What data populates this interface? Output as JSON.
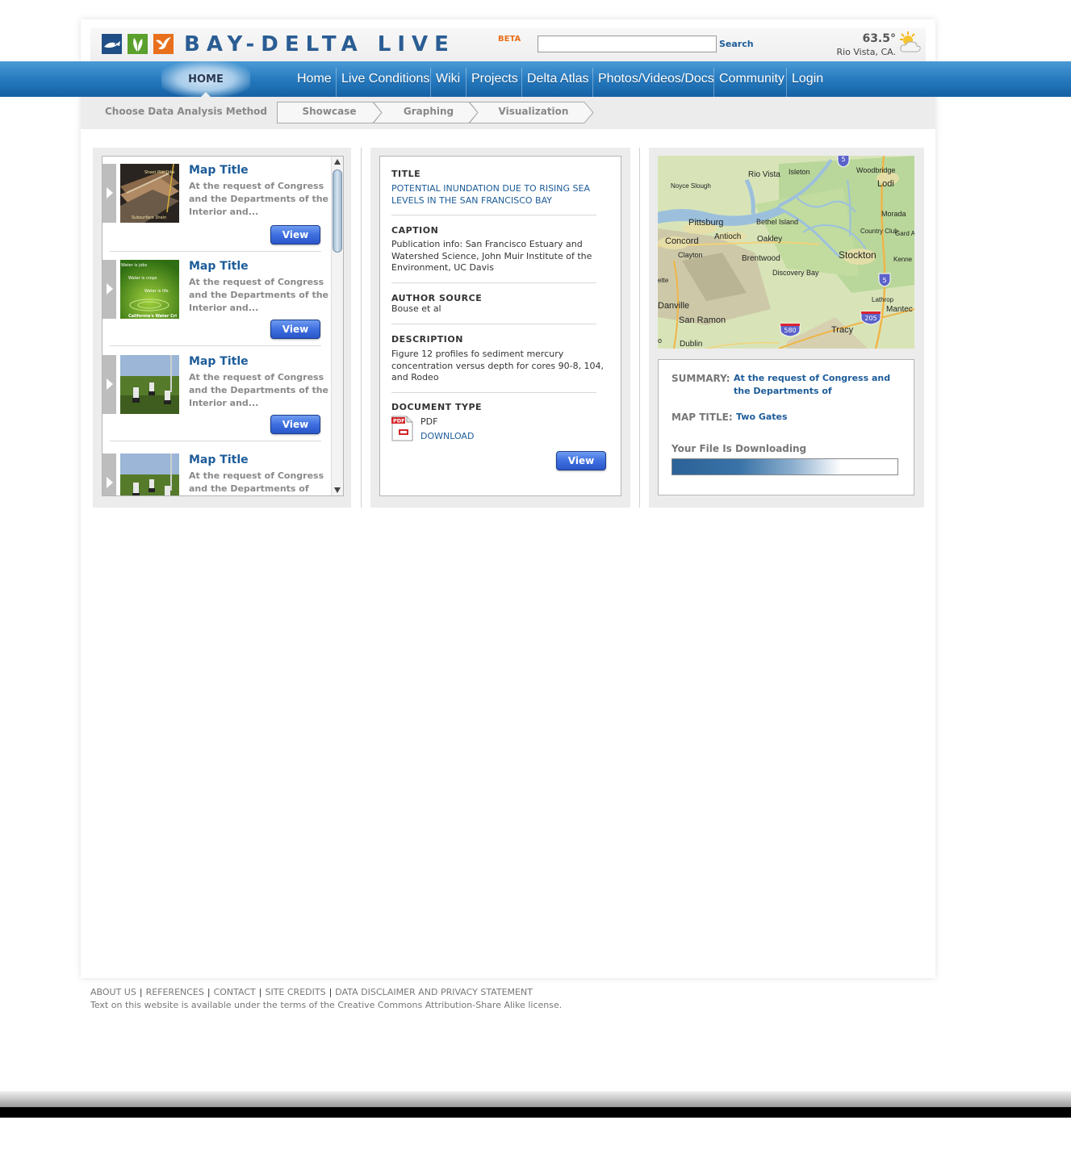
{
  "header": {
    "brand": "BAY-DELTA LIVE",
    "beta": "BETA",
    "search_placeholder": "",
    "search_label": "Search",
    "weather": {
      "temp": "63.5°",
      "city": "Rio Vista, CA.",
      "icon": "partly-cloudy-icon"
    }
  },
  "nav": {
    "home": "HOME",
    "items": [
      "Home",
      "Live Conditions",
      "Wiki",
      "Projects",
      "Delta Atlas",
      "Photos/Videos/Docs",
      "Community",
      "Login"
    ]
  },
  "breadcrumb": {
    "label": "Choose Data Analysis Method",
    "steps": [
      "Showcase",
      "Graphing",
      "Visualization"
    ]
  },
  "list": {
    "items": [
      {
        "title": "Map Title",
        "desc": "At the request of Congress and the Departments of the Interior and...",
        "button": "View"
      },
      {
        "title": "Map Title",
        "desc": "At the request of Congress and the Departments of the Interior and...",
        "button": "View"
      },
      {
        "title": "Map Title",
        "desc": "At the request of Congress and the Departments of the Interior and...",
        "button": "View"
      },
      {
        "title": "Map Title",
        "desc": "At the request of Congress and the Departments of",
        "button": "View"
      }
    ],
    "thumb_text": {
      "t1": [
        "Sheet Pile Dike",
        "Subsurface Drain"
      ],
      "t2": [
        "Water is jobs",
        "Water is crops",
        "Water is life",
        "California's Water Cri"
      ]
    }
  },
  "details": {
    "title_label": "TITLE",
    "title_value": "POTENTIAL INUNDATION DUE TO RISING SEA LEVELS IN THE SAN FRANCISCO BAY",
    "caption_label": "CAPTION",
    "caption_value": "Publication info: San Francisco Estuary and Watershed Science, John Muir Institute of the Environment, UC Davis",
    "author_label": "AUTHOR SOURCE",
    "author_value": "Bouse et al",
    "description_label": "DESCRIPTION",
    "description_value": "Figure 12 profiles fo sediment mercury concentration versus depth for cores 90-8, 104, and Rodeo",
    "doctype_label": "DOCUMENT TYPE",
    "doctype_value": "PDF",
    "pdf_badge": "PDF",
    "download": "DOWNLOAD",
    "button": "View"
  },
  "map": {
    "places": [
      "Rio Vista",
      "Isleton",
      "Woodbridge",
      "Lodi",
      "Noyce Slough",
      "Pittsburg",
      "Bethel Island",
      "Morada",
      "Concord",
      "Antioch",
      "Oakley",
      "Country Club",
      "Gard Acre",
      "Clayton",
      "Brentwood",
      "Stockton",
      "Kenne",
      "Discovery Bay",
      "Danville",
      "Lathrop",
      "Mantec",
      "San Ramon",
      "Tracy",
      "Dublin",
      "ette",
      "o"
    ],
    "shields": [
      "5",
      "5",
      "580",
      "205"
    ]
  },
  "summary": {
    "summary_label": "SUMMARY:",
    "summary_value": "At the request of Congress and the Departments of",
    "map_title_label": "MAP TITLE:",
    "map_title_value": "Two Gates",
    "download_status": "Your File Is Downloading",
    "progress": 0.6
  },
  "footer": {
    "links": [
      "ABOUT US",
      "REFERENCES",
      "CONTACT",
      "SITE CREDITS",
      "DATA DISCLAIMER AND PRIVACY STATEMENT"
    ],
    "note": "Text on this website is available under the terms of the Creative Commons Attribution-Share Alike license."
  }
}
